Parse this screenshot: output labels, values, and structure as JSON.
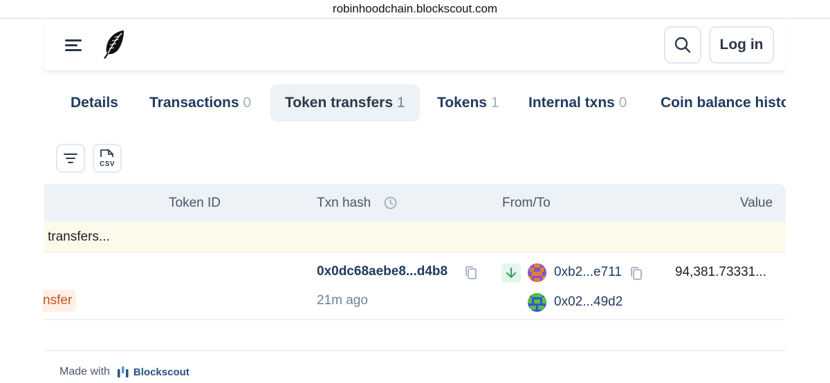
{
  "browser": {
    "url": "robinhoodchain.blockscout.com"
  },
  "header": {
    "login_label": "Log in"
  },
  "tabs": [
    {
      "label": "Details",
      "count": ""
    },
    {
      "label": "Transactions",
      "count": "0"
    },
    {
      "label": "Token transfers",
      "count": "1"
    },
    {
      "label": "Tokens",
      "count": "1"
    },
    {
      "label": "Internal txns",
      "count": "0"
    },
    {
      "label": "Coin balance histo",
      "count": ""
    }
  ],
  "toolbar": {
    "csv_label": "CSV"
  },
  "table": {
    "headers": {
      "token_id": "Token ID",
      "txn_hash": "Txn hash",
      "from_to": "From/To",
      "value": "Value"
    },
    "notice": "transfers...",
    "rows": [
      {
        "method": "nsfer",
        "txn_hash": "0x0dc68aebe8...d4b8",
        "age": "21m ago",
        "from": "0xb2...e711",
        "to": "0x02...49d2",
        "value": "94,381.73331..."
      }
    ]
  },
  "footer": {
    "made_with": "Made with",
    "brand": "Blockscout"
  },
  "colors": {
    "accent": "#1f3a5f",
    "notice_bg": "#fefaeb",
    "method": "#c05621",
    "in_arrow": "#38a169"
  }
}
